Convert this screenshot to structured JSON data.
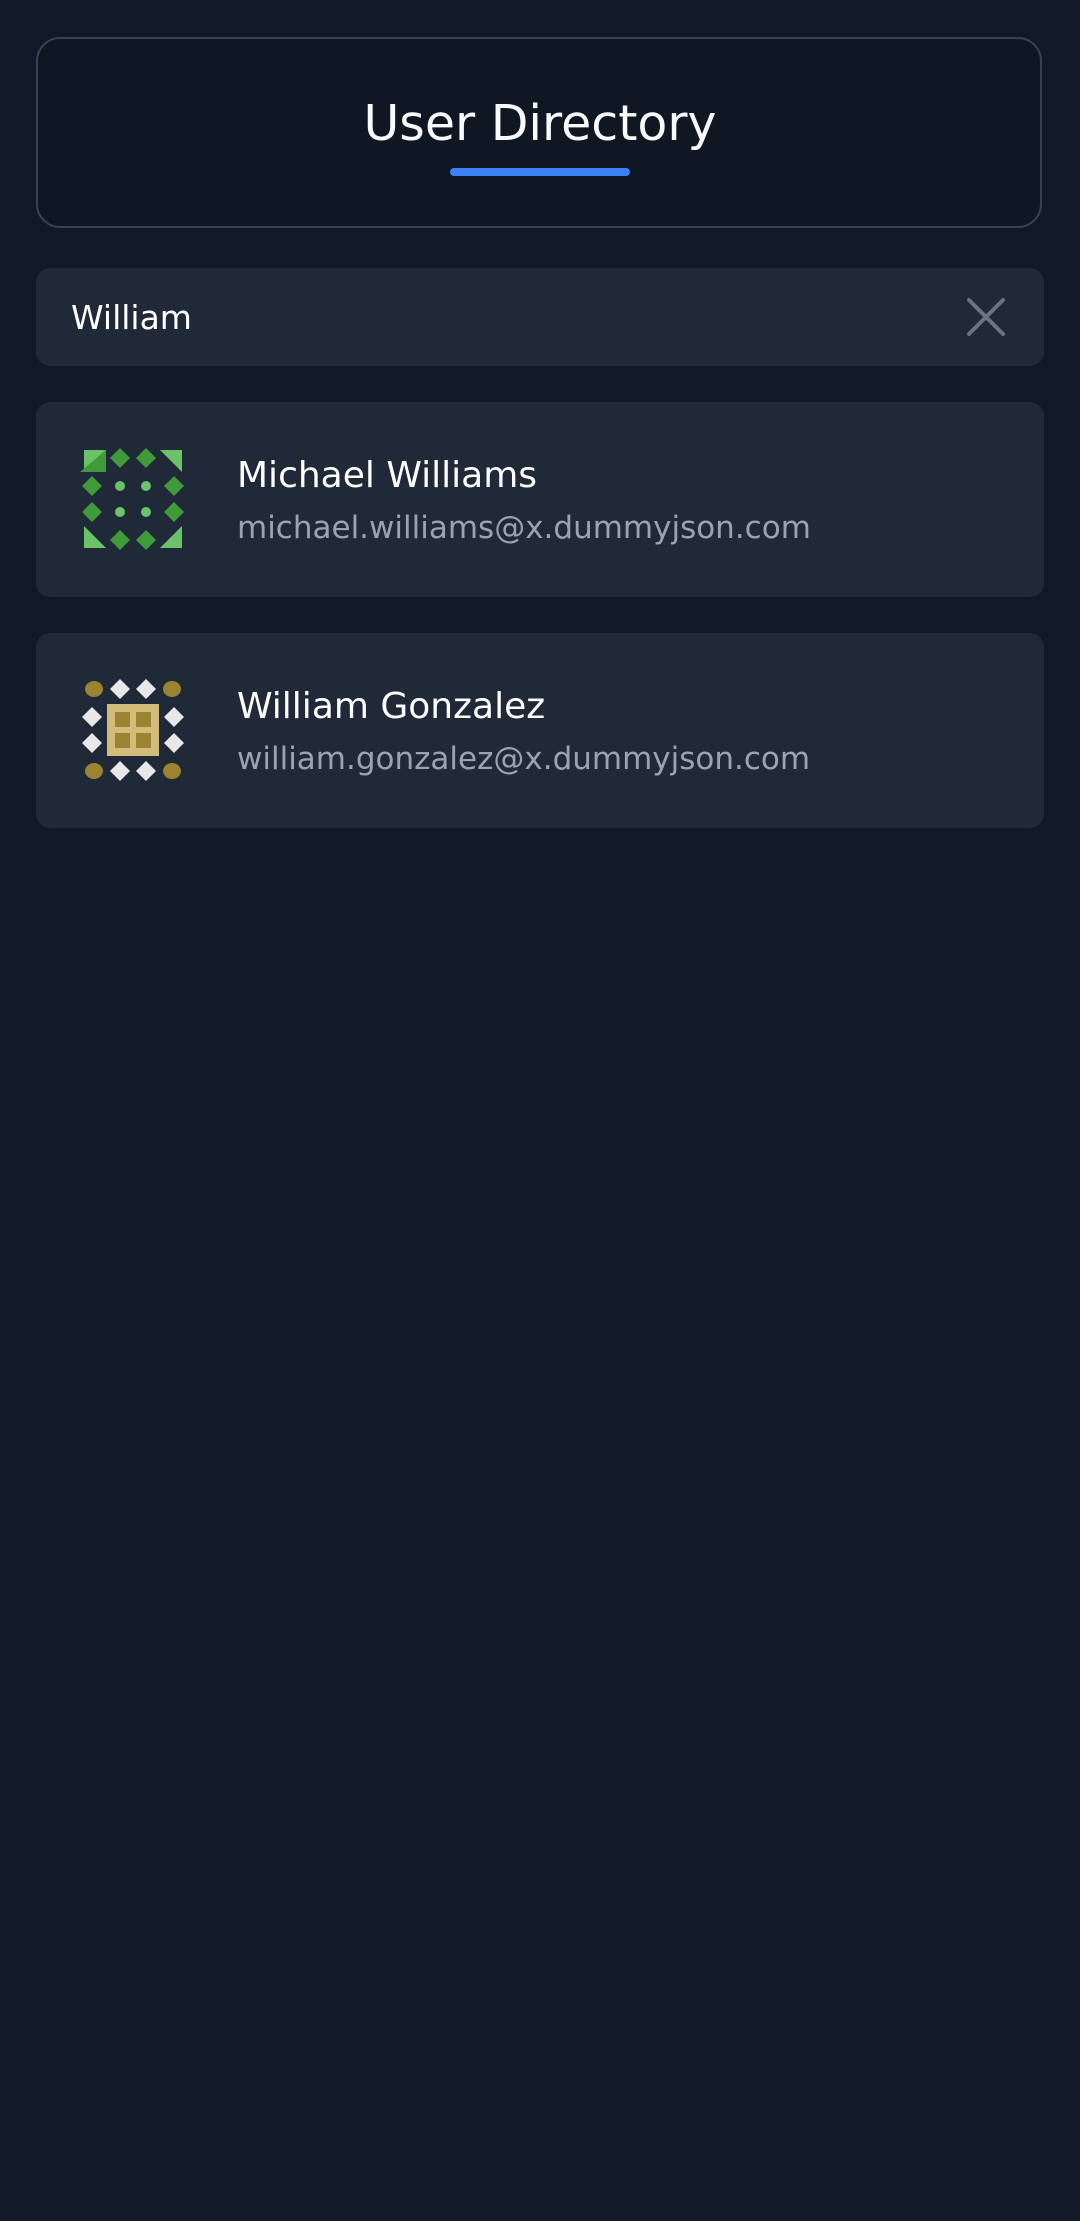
{
  "header": {
    "title": "User Directory",
    "accent_color": "#3b82f6"
  },
  "search": {
    "value": "William",
    "placeholder": "",
    "clear_icon": "close-icon"
  },
  "users": [
    {
      "name": "Michael Williams",
      "email": "michael.williams@x.dummyjson.com",
      "avatar": "identicon-green",
      "avatar_colors": [
        "#3f9a3a",
        "#6cc268"
      ]
    },
    {
      "name": "William Gonzalez",
      "email": "william.gonzalez@x.dummyjson.com",
      "avatar": "identicon-gold",
      "avatar_colors": [
        "#9b8332",
        "#d1bc7a",
        "#e8e8e8"
      ]
    }
  ]
}
